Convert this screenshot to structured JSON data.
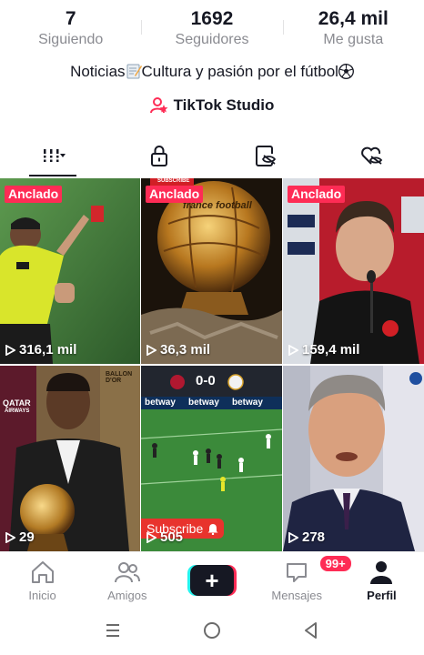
{
  "stats": [
    {
      "value": "7",
      "label": "Siguiendo"
    },
    {
      "value": "1692",
      "label": "Seguidores"
    },
    {
      "value": "26,4 mil",
      "label": "Me gusta"
    }
  ],
  "bio": {
    "part1": "Noticias",
    "part2": "Cultura y pasión por el fútbol"
  },
  "studio": {
    "label": "TikTok Studio"
  },
  "tabs": [
    "videos-grid",
    "private",
    "reposts",
    "liked"
  ],
  "videos": [
    {
      "pinned": "Anclado",
      "views": "316,1 mil"
    },
    {
      "pinned": "Anclado",
      "views": "36,3 mil",
      "overlay_top": "SUBSCRIBE",
      "overlay_mid": "france football"
    },
    {
      "pinned": "Anclado",
      "views": "159,4 mil"
    },
    {
      "pinned": "",
      "views": "29",
      "overlay_top": "QATAR",
      "overlay_sub": "AIRWAYS",
      "overlay_right": "BALLON D'OR"
    },
    {
      "pinned": "",
      "views": "505",
      "overlay_score": "0-0",
      "overlay_sponsor": "betway",
      "subscribe": "Subscribe"
    },
    {
      "pinned": "",
      "views": "278"
    }
  ],
  "nav": {
    "home": "Inicio",
    "friends": "Amigos",
    "messages": "Mensajes",
    "messages_badge": "99+",
    "profile": "Perfil"
  },
  "colors": {
    "accent": "#fe2c55",
    "cyan": "#25f4ee",
    "text": "#161823",
    "muted": "#8a8b91"
  }
}
